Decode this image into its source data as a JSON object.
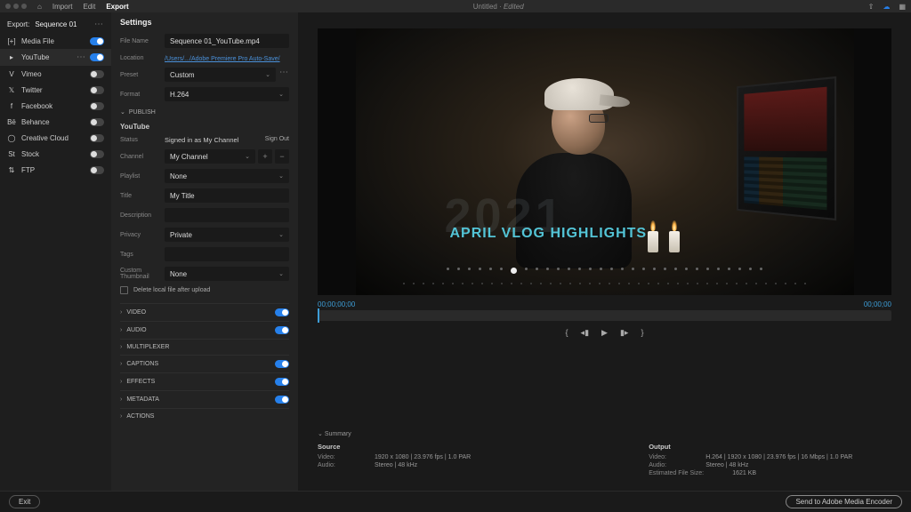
{
  "topbar": {
    "home": "⌂",
    "menu": [
      "Import",
      "Edit",
      "Export"
    ],
    "title": "Untitled",
    "titleSuffix": "Edited",
    "icons": [
      "share",
      "cloud",
      "panel"
    ]
  },
  "export": {
    "label": "Export:",
    "sequence": "Sequence 01"
  },
  "destinations": [
    {
      "name": "Media File",
      "icon": "[+]",
      "on": true,
      "active": false,
      "dots": false
    },
    {
      "name": "YouTube",
      "icon": "▸",
      "on": true,
      "active": true,
      "dots": true
    },
    {
      "name": "Vimeo",
      "icon": "V",
      "on": false,
      "active": false,
      "dots": false
    },
    {
      "name": "Twitter",
      "icon": "𝕏",
      "on": false,
      "active": false,
      "dots": false
    },
    {
      "name": "Facebook",
      "icon": "f",
      "on": false,
      "active": false,
      "dots": false
    },
    {
      "name": "Behance",
      "icon": "Bē",
      "on": false,
      "active": false,
      "dots": false
    },
    {
      "name": "Creative Cloud",
      "icon": "◯",
      "on": false,
      "active": false,
      "dots": false
    },
    {
      "name": "Stock",
      "icon": "St",
      "on": false,
      "active": false,
      "dots": false
    },
    {
      "name": "FTP",
      "icon": "⇅",
      "on": false,
      "active": false,
      "dots": false
    }
  ],
  "settings": {
    "heading": "Settings",
    "file_name_label": "File Name",
    "file_name": "Sequence 01_YouTube.mp4",
    "location_label": "Location",
    "location": "/Users/.../Adobe Premiere Pro Auto-Save/",
    "preset_label": "Preset",
    "preset": "Custom",
    "format_label": "Format",
    "format": "H.264",
    "publish_header": "PUBLISH",
    "youtube_header": "YouTube",
    "status_label": "Status",
    "status": "Signed in as My Channel",
    "sign_out": "Sign Out",
    "channel_label": "Channel",
    "channel": "My Channel",
    "playlist_label": "Playlist",
    "playlist": "None",
    "title_label": "Title",
    "title": "My Title",
    "description_label": "Description",
    "description": "",
    "privacy_label": "Privacy",
    "privacy": "Private",
    "tags_label": "Tags",
    "tags": "",
    "thumb_label": "Custom Thumbnail",
    "thumb": "None",
    "delete_after": "Delete local file after upload"
  },
  "accordion": [
    {
      "label": "VIDEO",
      "toggle": true,
      "on": true
    },
    {
      "label": "AUDIO",
      "toggle": true,
      "on": true
    },
    {
      "label": "MULTIPLEXER",
      "toggle": false
    },
    {
      "label": "CAPTIONS",
      "toggle": true,
      "on": true
    },
    {
      "label": "EFFECTS",
      "toggle": true,
      "on": true
    },
    {
      "label": "METADATA",
      "toggle": true,
      "on": true
    },
    {
      "label": "ACTIONS",
      "toggle": false
    }
  ],
  "preview": {
    "overlay_year": "2021",
    "overlay_title": "APRIL VLOG HIGHLIGHTS",
    "timecode_start": "00;00;00;00",
    "timecode_end": "00;00;00",
    "transport": {
      "in": "{",
      "prev": "◂▮",
      "back": "◂◂",
      "play": "▶",
      "next": "▮▸",
      "out": "}"
    }
  },
  "summary": {
    "header": "Summary",
    "source": {
      "h": "Source",
      "video_k": "Video:",
      "video_v": "1920 x 1080 | 23.976 fps | 1.0 PAR",
      "audio_k": "Audio:",
      "audio_v": "Stereo | 48 kHz"
    },
    "output": {
      "h": "Output",
      "video_k": "Video:",
      "video_v": "H.264 | 1920 x 1080 | 23.976 fps | 16 Mbps | 1.0 PAR",
      "audio_k": "Audio:",
      "audio_v": "Stereo | 48 kHz",
      "size_k": "Estimated File Size:",
      "size_v": "1621 KB"
    }
  },
  "footer": {
    "exit": "Exit",
    "send": "Send to Adobe Media Encoder"
  }
}
